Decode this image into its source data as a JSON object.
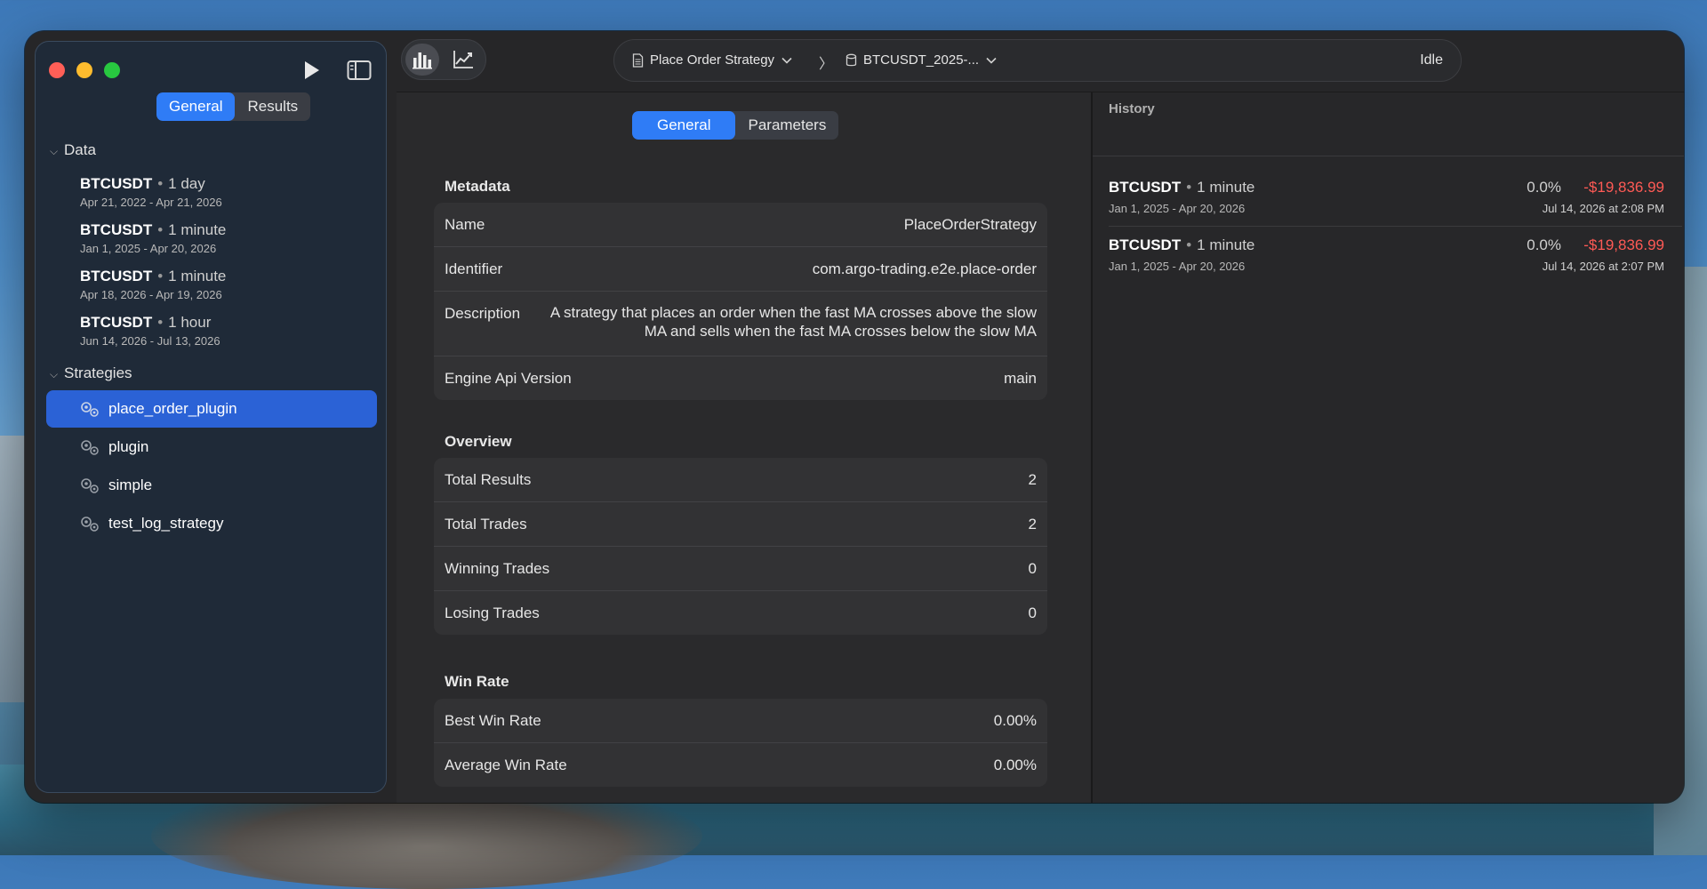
{
  "window": {
    "toolbar": {
      "breadcrumb_strategy": "Place Order Strategy",
      "breadcrumb_dataset": "BTCUSDT_2025-...",
      "breadcrumb_separator": "〉",
      "status": "Idle"
    }
  },
  "sidebar": {
    "tabs": [
      {
        "label": "General",
        "active": true
      },
      {
        "label": "Results",
        "active": false
      }
    ],
    "data_header": "Data",
    "data_items": [
      {
        "symbol": "BTCUSDT",
        "interval": "1 day",
        "range": "Apr 21, 2022 - Apr 21, 2026"
      },
      {
        "symbol": "BTCUSDT",
        "interval": "1 minute",
        "range": "Jan 1, 2025 - Apr 20, 2026"
      },
      {
        "symbol": "BTCUSDT",
        "interval": "1 minute",
        "range": "Apr 18, 2026 - Apr 19, 2026"
      },
      {
        "symbol": "BTCUSDT",
        "interval": "1 hour",
        "range": "Jun 14, 2026 - Jul 13, 2026"
      }
    ],
    "strategies_header": "Strategies",
    "strategies": [
      {
        "label": "place_order_plugin",
        "selected": true
      },
      {
        "label": "plugin",
        "selected": false
      },
      {
        "label": "simple",
        "selected": false
      },
      {
        "label": "test_log_strategy",
        "selected": false
      }
    ]
  },
  "main": {
    "tabs": [
      {
        "label": "General",
        "active": true
      },
      {
        "label": "Parameters",
        "active": false
      }
    ],
    "metadata": {
      "title": "Metadata",
      "rows": [
        {
          "key": "Name",
          "value": "PlaceOrderStrategy"
        },
        {
          "key": "Identifier",
          "value": "com.argo-trading.e2e.place-order"
        },
        {
          "key": "Description",
          "value": "A strategy that places an order when the fast MA crosses above the slow MA and sells when the fast MA crosses below the slow MA"
        },
        {
          "key": "Engine Api Version",
          "value": "main"
        }
      ]
    },
    "overview": {
      "title": "Overview",
      "rows": [
        {
          "key": "Total Results",
          "value": "2"
        },
        {
          "key": "Total Trades",
          "value": "2"
        },
        {
          "key": "Winning Trades",
          "value": "0"
        },
        {
          "key": "Losing Trades",
          "value": "0"
        }
      ]
    },
    "win_rate": {
      "title": "Win Rate",
      "rows": [
        {
          "key": "Best Win Rate",
          "value": "0.00%"
        },
        {
          "key": "Average Win Rate",
          "value": "0.00%"
        }
      ]
    }
  },
  "history": {
    "title": "History",
    "items": [
      {
        "symbol": "BTCUSDT",
        "interval": "1 minute",
        "range": "Jan 1, 2025 - Apr 20, 2026",
        "percent": "0.0%",
        "pnl": "-$19,836.99",
        "timestamp": "Jul 14, 2026 at 2:08 PM"
      },
      {
        "symbol": "BTCUSDT",
        "interval": "1 minute",
        "range": "Jan 1, 2025 - Apr 20, 2026",
        "percent": "0.0%",
        "pnl": "-$19,836.99",
        "timestamp": "Jul 14, 2026 at 2:07 PM"
      }
    ]
  },
  "colors": {
    "accent": "#2f7cf6",
    "selection": "#2b62d6",
    "negative": "#ff5a55"
  },
  "icons": {
    "run": "play-icon",
    "sidebar": "sidebar-toggle-icon",
    "bar_chart": "bar-chart-icon",
    "line_chart": "line-chart-icon",
    "document": "document-icon",
    "database": "database-icon",
    "strategy": "gears-icon"
  }
}
